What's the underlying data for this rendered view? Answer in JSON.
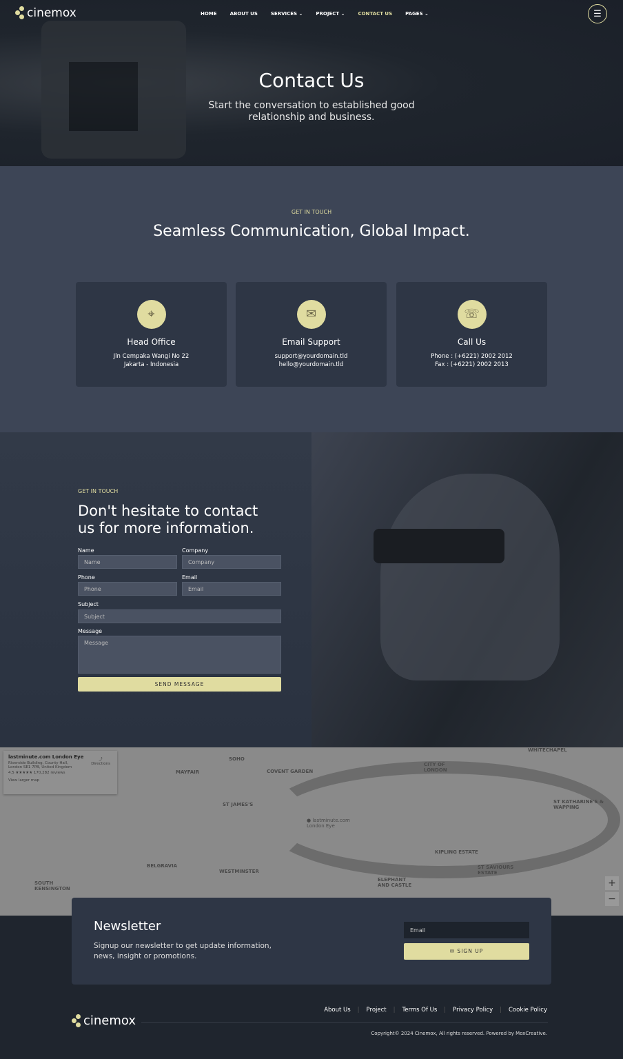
{
  "brand": "cinemox",
  "nav": [
    {
      "label": "HOME"
    },
    {
      "label": "ABOUT US"
    },
    {
      "label": "SERVICES ⌄"
    },
    {
      "label": "PROJECT ⌄"
    },
    {
      "label": "CONTACT US"
    },
    {
      "label": "PAGES ⌄"
    }
  ],
  "hero": {
    "title": "Contact Us",
    "subtitle": "Start the conversation to established good relationship and business."
  },
  "touch": {
    "eyebrow": "GET IN TOUCH",
    "title": "Seamless Communication, Global Impact.",
    "cards": [
      {
        "icon": "map-pin-icon",
        "title": "Head Office",
        "l1": "Jln Cempaka Wangi No 22",
        "l2": "Jakarta - Indonesia"
      },
      {
        "icon": "mail-icon",
        "title": "Email Support",
        "l1": "support@yourdomain.tld",
        "l2": "hello@yourdomain.tld"
      },
      {
        "icon": "phone-icon",
        "title": "Call Us",
        "l1": "Phone : (+6221) 2002 2012",
        "l2": "Fax : (+6221) 2002 2013"
      }
    ]
  },
  "form": {
    "eyebrow": "GET IN TOUCH",
    "title": "Don't hesitate to contact us for more information.",
    "name_label": "Name",
    "name_ph": "Name",
    "company_label": "Company",
    "company_ph": "Company",
    "phone_label": "Phone",
    "phone_ph": "Phone",
    "email_label": "Email",
    "email_ph": "Email",
    "subject_label": "Subject",
    "subject_ph": "Subject",
    "message_label": "Message",
    "message_ph": "Message",
    "submit": "SEND MESSAGE"
  },
  "map": {
    "place": "lastminute.com London Eye",
    "address": "Riverside Building, County Hall, London SE1 7PB, United Kingdom",
    "rating": "4.5 ★★★★★",
    "reviews": "170,282 reviews",
    "directions": "Directions",
    "larger": "View larger map",
    "labels": [
      "SOHO",
      "MAYFAIR",
      "COVENT GARDEN",
      "CITY OF LONDON",
      "WHITECHAPEL",
      "ST JAMES'S",
      "ST KATHARINE'S & WAPPING",
      "BELGRAVIA",
      "WESTMINSTER",
      "SOUTH KENSINGTON",
      "KIPLING ESTATE",
      "ELEPHANT AND CASTLE",
      "ST SAVIOURS ESTATE",
      "lastminute.com London Eye"
    ]
  },
  "newsletter": {
    "title": "Newsletter",
    "text": "Signup our newsletter to get update information, news, insight or promotions.",
    "email_ph": "Email",
    "button": "✉ SIGN UP"
  },
  "footer": {
    "links": [
      "About Us",
      "Project",
      "Terms Of Us",
      "Privacy Policy",
      "Cookie Policy"
    ],
    "copyright": "Copyright© 2024 Cinemox, All rights reserved. Powered by MoxCreative."
  },
  "colors": {
    "accent": "#e0dca0",
    "section": "#3d4556",
    "card": "#2e3645"
  }
}
